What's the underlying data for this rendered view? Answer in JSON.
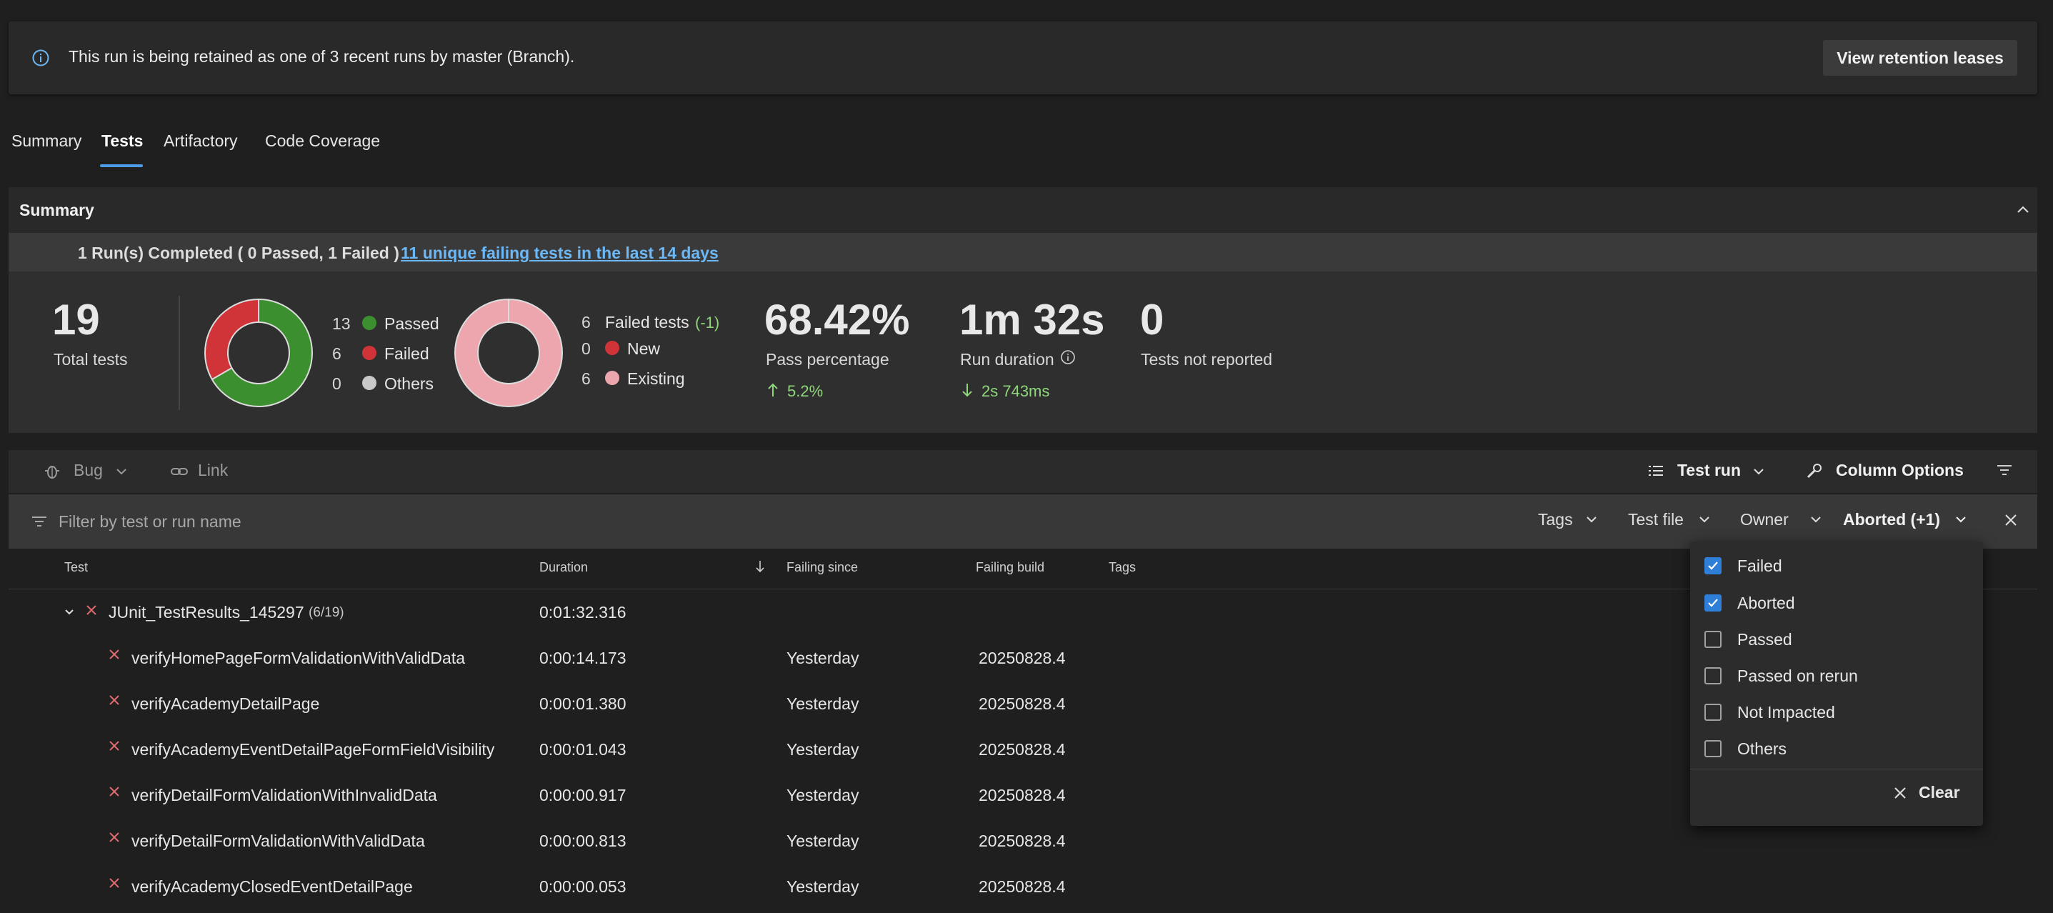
{
  "banner": {
    "message": "This run is being retained as one of 3 recent runs by master (Branch).",
    "button_label": "View retention leases"
  },
  "tabs": [
    {
      "label": "Summary"
    },
    {
      "label": "Tests"
    },
    {
      "label": "Artifactory"
    },
    {
      "label": "Code Coverage"
    }
  ],
  "summary": {
    "title": "Summary",
    "runs_text": "1 Run(s) Completed ( 0 Passed, 1 Failed )",
    "failing_link": "11 unique failing tests in the last 14 days",
    "total": {
      "value": "19",
      "label": "Total tests"
    },
    "outcome_legend": [
      {
        "count": "13",
        "label": "Passed",
        "color": "#3b8f2e"
      },
      {
        "count": "6",
        "label": "Failed",
        "color": "#d13438"
      },
      {
        "count": "0",
        "label": "Others",
        "color": "#c8c8c8"
      }
    ],
    "failed_legend": {
      "header_count": "6",
      "header_label": "Failed tests",
      "header_delta": "(-1)",
      "items": [
        {
          "count": "0",
          "label": "New",
          "color": "#d13438"
        },
        {
          "count": "6",
          "label": "Existing",
          "color": "#eda6ad"
        }
      ]
    },
    "pass_percentage": {
      "value": "68.42%",
      "label": "Pass percentage",
      "delta": "5.2%"
    },
    "run_duration": {
      "value": "1m 32s",
      "label": "Run duration",
      "delta": "2s 743ms"
    },
    "not_reported": {
      "value": "0",
      "label": "Tests not reported"
    }
  },
  "toolbar": {
    "bug_label": "Bug",
    "link_label": "Link",
    "test_run_label": "Test run",
    "column_options_label": "Column Options"
  },
  "filterbar": {
    "placeholder": "Filter by test or run name",
    "tags": "Tags",
    "test_file": "Test file",
    "owner": "Owner",
    "outcome": "Aborted (+1)"
  },
  "table": {
    "headers": {
      "test": "Test",
      "duration": "Duration",
      "failing_since": "Failing since",
      "failing_build": "Failing build",
      "tags": "Tags"
    },
    "group": {
      "name": "JUnit_TestResults_145297",
      "count": "(6/19)",
      "duration": "0:01:32.316"
    },
    "rows": [
      {
        "name": "verifyHomePageFormValidationWithValidData",
        "duration": "0:00:14.173",
        "since": "Yesterday",
        "build": "20250828.4"
      },
      {
        "name": "verifyAcademyDetailPage",
        "duration": "0:00:01.380",
        "since": "Yesterday",
        "build": "20250828.4"
      },
      {
        "name": "verifyAcademyEventDetailPageFormFieldVisibility",
        "duration": "0:00:01.043",
        "since": "Yesterday",
        "build": "20250828.4"
      },
      {
        "name": "verifyDetailFormValidationWithInvalidData",
        "duration": "0:00:00.917",
        "since": "Yesterday",
        "build": "20250828.4"
      },
      {
        "name": "verifyDetailFormValidationWithValidData",
        "duration": "0:00:00.813",
        "since": "Yesterday",
        "build": "20250828.4"
      },
      {
        "name": "verifyAcademyClosedEventDetailPage",
        "duration": "0:00:00.053",
        "since": "Yesterday",
        "build": "20250828.4"
      }
    ]
  },
  "outcome_dropdown": {
    "options": [
      {
        "label": "Failed",
        "checked": true
      },
      {
        "label": "Aborted",
        "checked": true
      },
      {
        "label": "Passed",
        "checked": false
      },
      {
        "label": "Passed on rerun",
        "checked": false
      },
      {
        "label": "Not Impacted",
        "checked": false
      },
      {
        "label": "Others",
        "checked": false
      }
    ],
    "clear_label": "Clear"
  }
}
